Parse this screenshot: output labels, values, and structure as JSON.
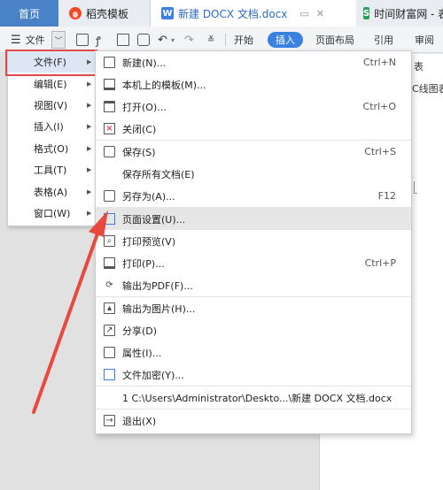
{
  "tabs": {
    "home": "首页",
    "template": "稻壳模板",
    "doc": "新建 DOCX 文档.docx",
    "doc_icon": "W",
    "sheet": "时间财富网 - 表",
    "sheet_icon": "S"
  },
  "toolbar": {
    "file_menu": "文件",
    "ribbon_tabs": [
      "开始",
      "插入",
      "页面布局",
      "引用",
      "审阅"
    ]
  },
  "left_menu": [
    {
      "label": "文件(F)",
      "active": true
    },
    {
      "label": "编辑(E)"
    },
    {
      "label": "视图(V)"
    },
    {
      "label": "插入(I)"
    },
    {
      "label": "格式(O)"
    },
    {
      "label": "工具(T)"
    },
    {
      "label": "表格(A)"
    },
    {
      "label": "窗口(W)"
    }
  ],
  "submenu": {
    "new": {
      "label": "新建(N)...",
      "shortcut": "Ctrl+N"
    },
    "local_templates": {
      "label": "本机上的模板(M)..."
    },
    "open": {
      "label": "打开(O)...",
      "shortcut": "Ctrl+O"
    },
    "close": {
      "label": "关闭(C)"
    },
    "save": {
      "label": "保存(S)",
      "shortcut": "Ctrl+S"
    },
    "save_all": {
      "label": "保存所有文档(E)"
    },
    "save_as": {
      "label": "另存为(A)...",
      "shortcut": "F12"
    },
    "page_setup": {
      "label": "页面设置(U)..."
    },
    "print_preview": {
      "label": "打印预览(V)"
    },
    "print": {
      "label": "打印(P)...",
      "shortcut": "Ctrl+P"
    },
    "export_pdf": {
      "label": "输出为PDF(F)..."
    },
    "export_image": {
      "label": "输出为图片(H)..."
    },
    "share": {
      "label": "分享(D)"
    },
    "properties": {
      "label": "属性(I)..."
    },
    "encrypt": {
      "label": "文件加密(Y)..."
    },
    "recent": {
      "label": "1 C:\\Users\\Administrator\\Deskto...\\新建 DOCX 文档.docx"
    },
    "exit": {
      "label": "退出(X)"
    }
  },
  "page_fragments": {
    "frag1": "表",
    "frag2": "C线图表"
  },
  "colors": {
    "accent": "#3b82e0",
    "highlight_border": "#e04a4a",
    "arrow": "#e8493f"
  }
}
